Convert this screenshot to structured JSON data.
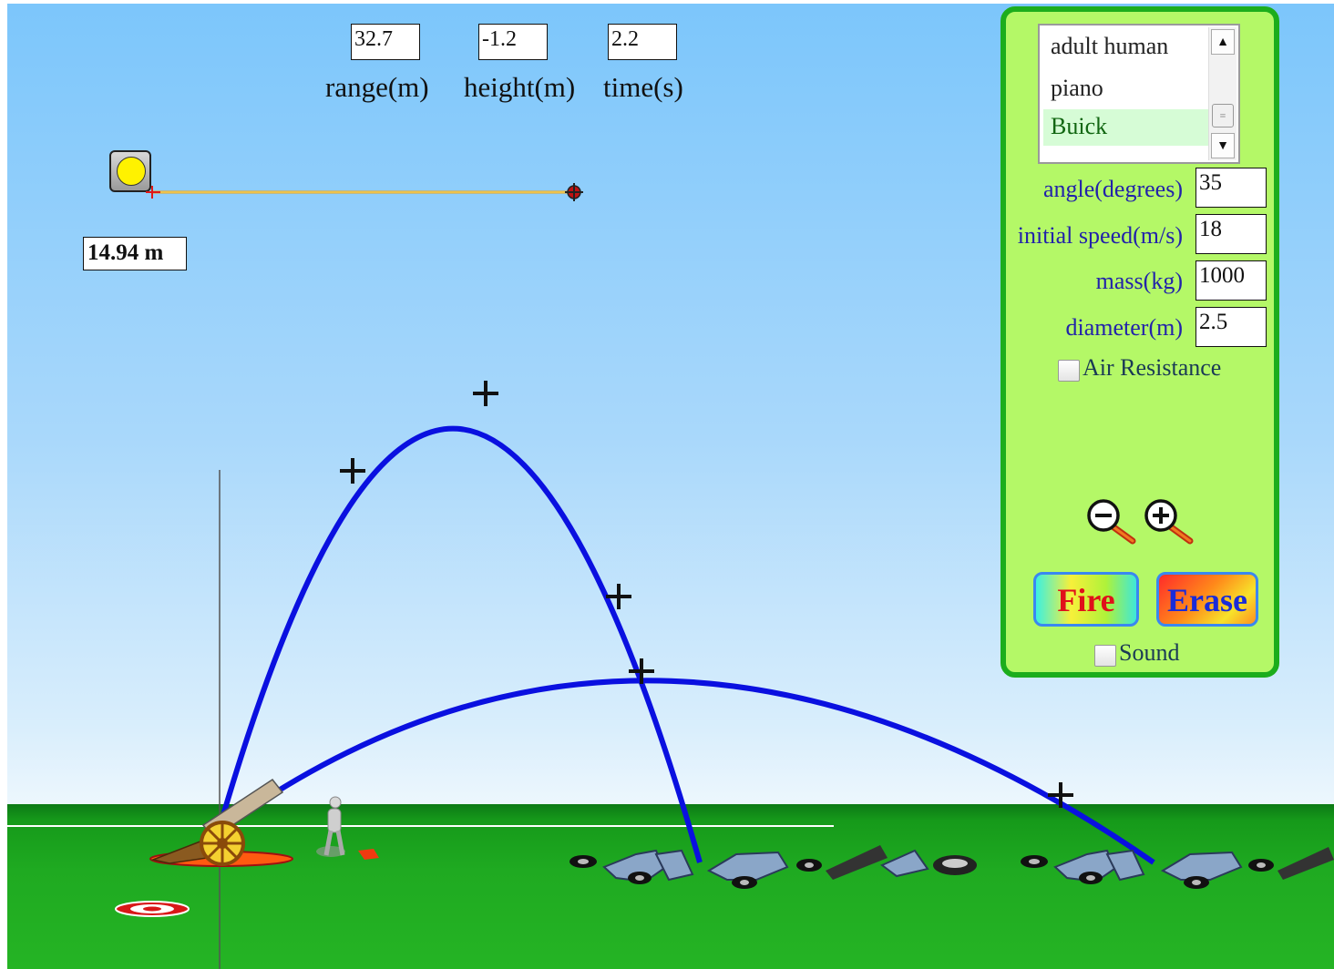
{
  "readouts": [
    {
      "value": "32.7",
      "label": "range(m)"
    },
    {
      "value": "-1.2",
      "label": "height(m)"
    },
    {
      "value": "2.2",
      "label": "time(s)"
    }
  ],
  "tape": {
    "reading": "14.94 m"
  },
  "panel": {
    "projectiles": [
      "adult human",
      "piano",
      "Buick"
    ],
    "selected_projectile": "Buick",
    "fields": [
      {
        "label": "angle(degrees)",
        "value": "35"
      },
      {
        "label": "initial speed(m/s)",
        "value": "18"
      },
      {
        "label": "mass(kg)",
        "value": "1000"
      },
      {
        "label": "diameter(m)",
        "value": "2.5"
      }
    ],
    "air_resistance": {
      "label": "Air Resistance",
      "checked": false
    },
    "sound": {
      "label": "Sound",
      "checked": false
    },
    "fire_label": "Fire",
    "erase_label": "Erase"
  },
  "colors": {
    "trajectory": "#0a10e0",
    "panel_bg": "#b4f867",
    "panel_border": "#1cad1c",
    "label_text": "#2222aa"
  }
}
